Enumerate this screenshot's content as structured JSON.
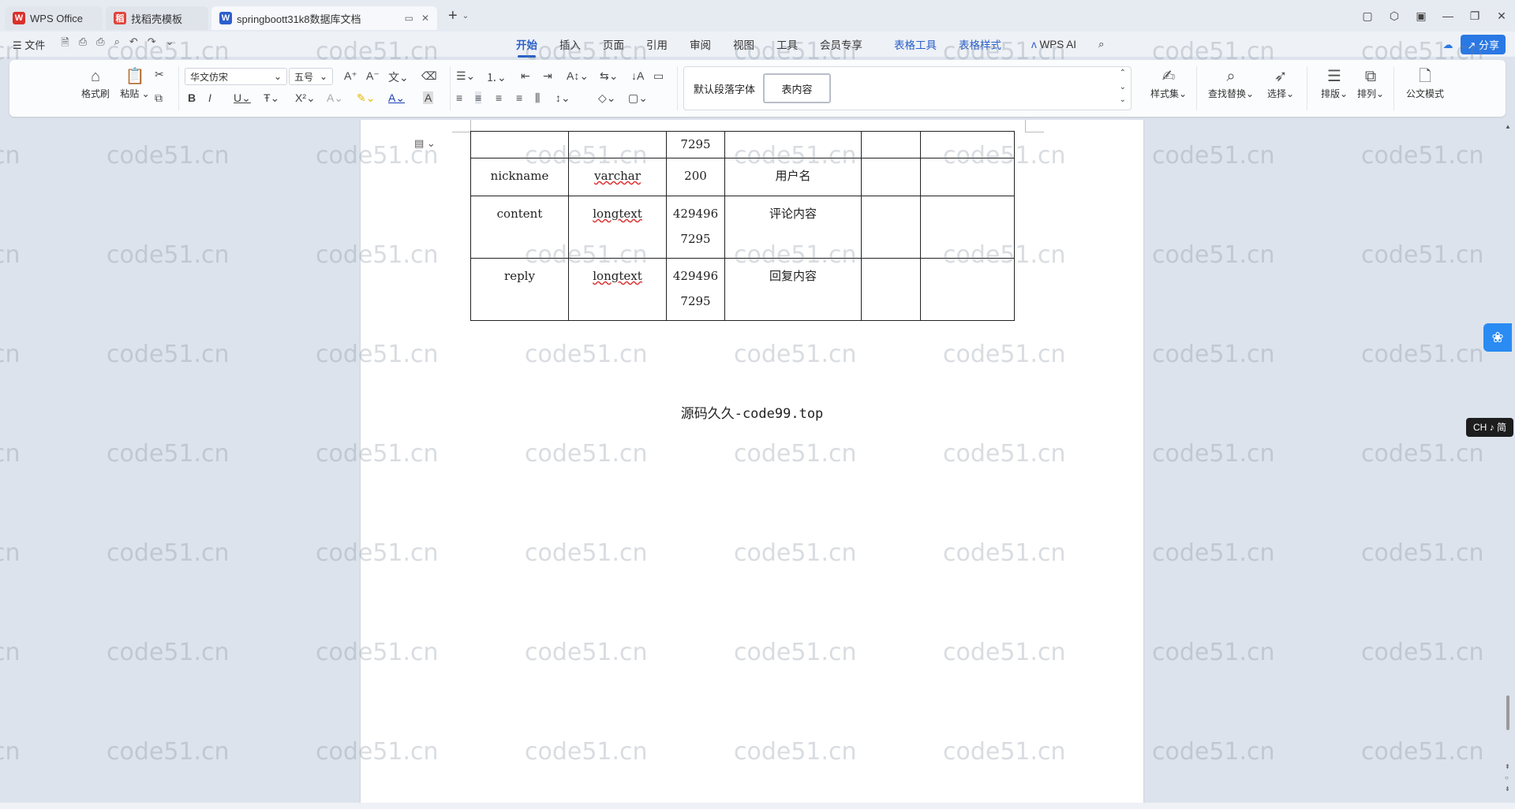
{
  "tabs": [
    {
      "label": "WPS Office",
      "icon": "wps-logo-icon"
    },
    {
      "label": "找稻壳模板",
      "icon": "docer-icon"
    },
    {
      "label": "springboott31k8数据库文档",
      "icon": "word-doc-icon"
    }
  ],
  "menu": {
    "file": "文件",
    "tabs": [
      "开始",
      "插入",
      "页面",
      "引用",
      "审阅",
      "视图",
      "工具",
      "会员专享"
    ],
    "context_tabs": [
      "表格工具",
      "表格样式"
    ],
    "ai": "WPS AI",
    "share": "分享"
  },
  "ribbon": {
    "format_painter": "格式刷",
    "paste": "粘贴",
    "font_name": "华文仿宋",
    "font_size": "五号",
    "style_default": "默认段落字体",
    "style_selected": "表内容",
    "style_set": "样式集",
    "find_replace": "查找替换",
    "select": "选择",
    "typeset": "排版",
    "arrange": "排列",
    "official_mode": "公文模式"
  },
  "table": {
    "rows": [
      [
        "",
        "",
        "7295",
        "",
        "",
        ""
      ],
      [
        "nickname",
        "varchar",
        "200",
        "用户名",
        "",
        ""
      ],
      [
        "content",
        "longtext",
        "429496\n7295",
        "评论内容",
        "",
        ""
      ],
      [
        "reply",
        "longtext",
        "429496\n7295",
        "回复内容",
        "",
        ""
      ]
    ]
  },
  "footer_text": "源码久久-code99.top",
  "watermark": "code51.cn",
  "ime": "CH ♪ 简",
  "colors": {
    "accent": "#2a60c8",
    "share": "#2a78e4",
    "float": "#2a8bf2"
  }
}
